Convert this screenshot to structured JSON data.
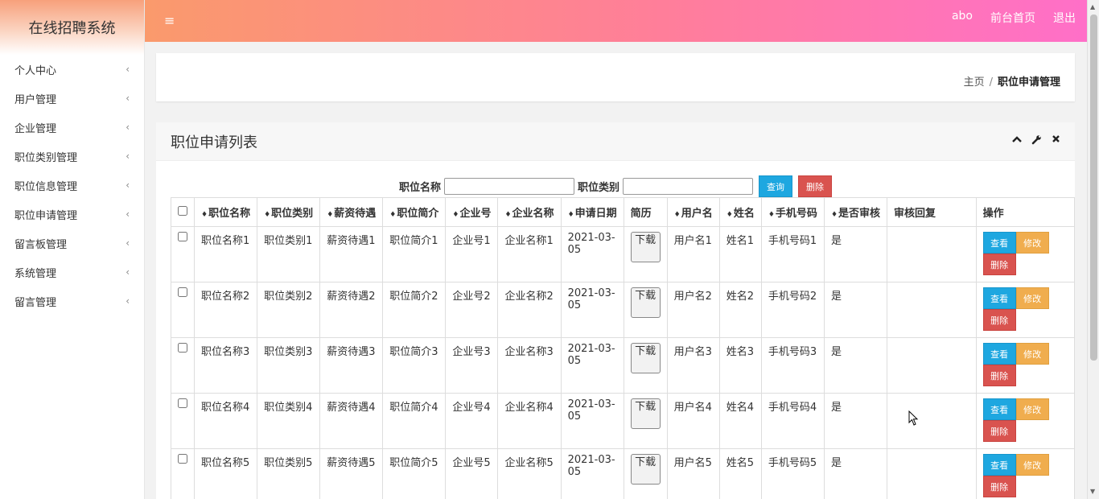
{
  "app": {
    "title": "在线招聘系统"
  },
  "sidebar": {
    "items": [
      {
        "label": "个人中心"
      },
      {
        "label": "用户管理"
      },
      {
        "label": "企业管理"
      },
      {
        "label": "职位类别管理"
      },
      {
        "label": "职位信息管理"
      },
      {
        "label": "职位申请管理"
      },
      {
        "label": "留言板管理"
      },
      {
        "label": "系统管理"
      },
      {
        "label": "留言管理"
      }
    ],
    "chevron": "‹"
  },
  "header": {
    "menu_icon": "≡",
    "links": {
      "user": "abo",
      "front": "前台首页",
      "logout": "退出"
    },
    "gradient": [
      "#fa9a6c",
      "#ff7e9a",
      "#ff6fc8"
    ]
  },
  "breadcrumb": {
    "home": "主页",
    "sep": "/",
    "current": "职位申请管理"
  },
  "panel": {
    "title": "职位申请列表",
    "tools": {
      "collapse": "^",
      "settings": "🔧",
      "close": "✖"
    }
  },
  "search": {
    "name_label": "职位名称",
    "type_label": "职位类别",
    "search_btn": "查询",
    "delete_btn": "删除"
  },
  "table": {
    "sort_glyph": "♦",
    "headers": {
      "name": "职位名称",
      "type": "职位类别",
      "salary": "薪资待遇",
      "intro": "职位简介",
      "company_no": "企业号",
      "company_name": "企业名称",
      "date": "申请日期",
      "resume": "简历",
      "username": "用户名",
      "realname": "姓名",
      "phone": "手机号码",
      "approved": "是否审核",
      "reply": "审核回复",
      "ops": "操作"
    },
    "rows": [
      {
        "name": "职位名称1",
        "type": "职位类别1",
        "salary": "薪资待遇1",
        "intro": "职位简介1",
        "company_no": "企业号1",
        "company_name": "企业名称1",
        "date": "2021-03-05",
        "resume": "下载",
        "username": "用户名1",
        "realname": "姓名1",
        "phone": "手机号码1",
        "approved": "是",
        "reply": ""
      },
      {
        "name": "职位名称2",
        "type": "职位类别2",
        "salary": "薪资待遇2",
        "intro": "职位简介2",
        "company_no": "企业号2",
        "company_name": "企业名称2",
        "date": "2021-03-05",
        "resume": "下载",
        "username": "用户名2",
        "realname": "姓名2",
        "phone": "手机号码2",
        "approved": "是",
        "reply": ""
      },
      {
        "name": "职位名称3",
        "type": "职位类别3",
        "salary": "薪资待遇3",
        "intro": "职位简介3",
        "company_no": "企业号3",
        "company_name": "企业名称3",
        "date": "2021-03-05",
        "resume": "下载",
        "username": "用户名3",
        "realname": "姓名3",
        "phone": "手机号码3",
        "approved": "是",
        "reply": ""
      },
      {
        "name": "职位名称4",
        "type": "职位类别4",
        "salary": "薪资待遇4",
        "intro": "职位简介4",
        "company_no": "企业号4",
        "company_name": "企业名称4",
        "date": "2021-03-05",
        "resume": "下载",
        "username": "用户名4",
        "realname": "姓名4",
        "phone": "手机号码4",
        "approved": "是",
        "reply": ""
      },
      {
        "name": "职位名称5",
        "type": "职位类别5",
        "salary": "薪资待遇5",
        "intro": "职位简介5",
        "company_no": "企业号5",
        "company_name": "企业名称5",
        "date": "2021-03-05",
        "resume": "下载",
        "username": "用户名5",
        "realname": "姓名5",
        "phone": "手机号码5",
        "approved": "是",
        "reply": ""
      }
    ],
    "row_actions": {
      "view": "查看",
      "edit": "修改",
      "delete": "删除"
    }
  },
  "colors": {
    "blue": "#1ea7e0",
    "orange": "#f0ad4e",
    "red": "#d9534f"
  }
}
